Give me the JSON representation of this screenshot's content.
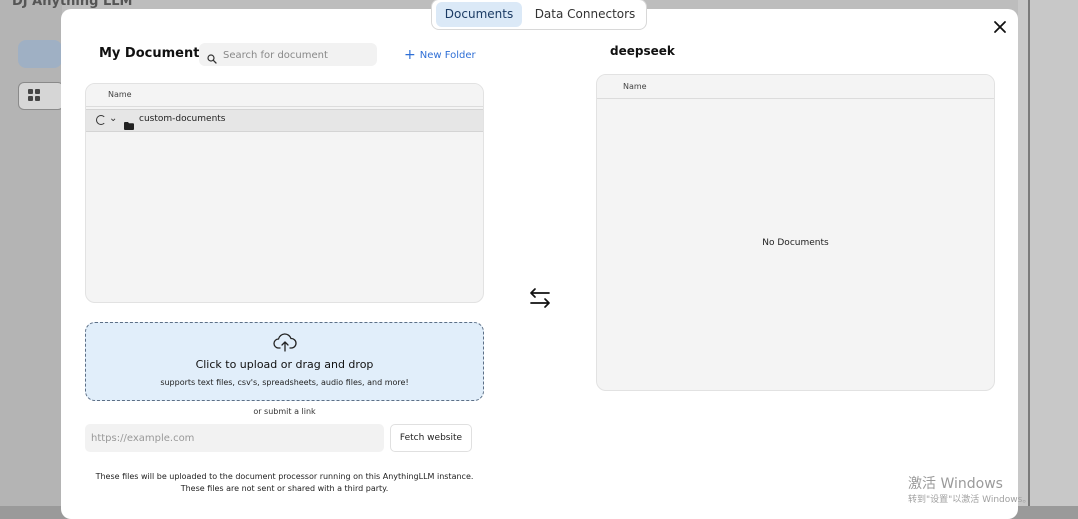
{
  "background_app": {
    "title": "DJ Anything LLM"
  },
  "tabs": [
    {
      "label": "Documents",
      "active": true
    },
    {
      "label": "Data Connectors",
      "active": false
    }
  ],
  "my_documents": {
    "title": "My Documents",
    "search_placeholder": "Search for document",
    "new_folder_label": "New Folder",
    "table_header": "Name",
    "rows": [
      {
        "name": "custom-documents",
        "type": "folder"
      }
    ]
  },
  "upload": {
    "title": "Click to upload or drag and drop",
    "subtitle": "supports text files, csv's, spreadsheets, audio files, and more!",
    "or_link": "or submit a link",
    "url_placeholder": "https://example.com",
    "fetch_label": "Fetch website",
    "disclaimer_line1": "These files will be uploaded to the document processor running on this AnythingLLM instance.",
    "disclaimer_line2": "These files are not sent or shared with a third party."
  },
  "workspace": {
    "title": "deepseek",
    "table_header": "Name",
    "empty_text": "No Documents"
  },
  "watermark": {
    "line1": "激活 Windows",
    "line2": "转到\"设置\"以激活 Windows。"
  },
  "icons": {
    "close": "close-icon",
    "search": "search-icon",
    "plus": "plus-icon",
    "upload": "cloud-upload-icon",
    "swap": "swap-arrows-icon",
    "folder": "folder-icon",
    "chevron": "chevron-down-icon"
  },
  "colors": {
    "accent": "#2f6fd6",
    "active_tab_bg": "#dbe9f7",
    "upload_bg": "#e1eefa"
  }
}
